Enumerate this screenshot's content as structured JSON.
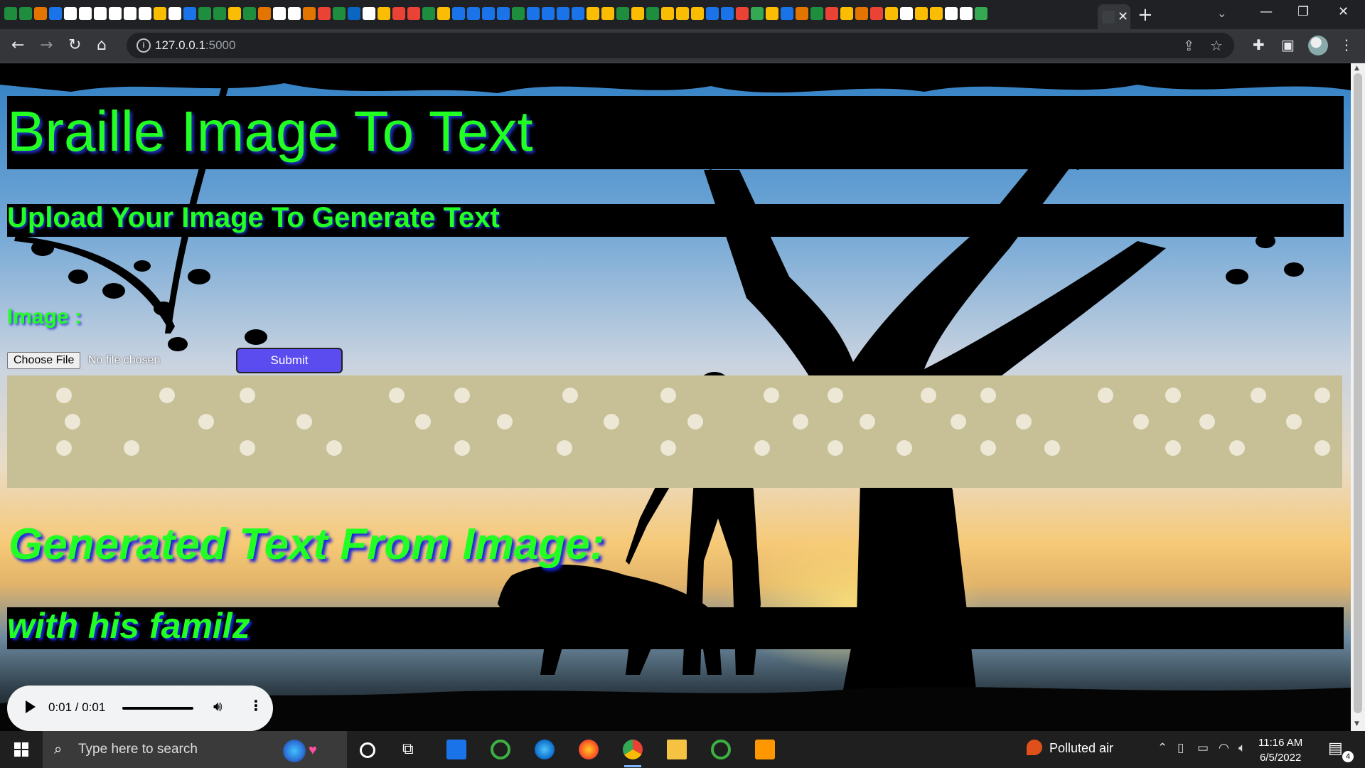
{
  "browser": {
    "url_host": "127.0.0.1",
    "url_port": ":5000",
    "new_tab_glyph": "+",
    "close_glyph": "✕",
    "window_controls": [
      "—",
      "❐",
      "✕"
    ],
    "tab_favicon_colors": [
      "#1e8e3e",
      "#1e8e3e",
      "#e37400",
      "#1a73e8",
      "#ffffff",
      "#ffffff",
      "#ffffff",
      "#ffffff",
      "#ffffff",
      "#ffffff",
      "#fbbc04",
      "#ffffff",
      "#1a73e8",
      "#1e8e3e",
      "#1e8e3e",
      "#fbbc04",
      "#1e8e3e",
      "#e37400",
      "#ffffff",
      "#ffffff",
      "#e37400",
      "#ea4335",
      "#1e8e3e",
      "#0a66c2",
      "#ffffff",
      "#fbbc04",
      "#ea4335",
      "#ea4335",
      "#1e8e3e",
      "#fbbc04",
      "#1a73e8",
      "#1a73e8",
      "#1a73e8",
      "#1a73e8",
      "#1e8e3e",
      "#1a73e8",
      "#1a73e8",
      "#1a73e8",
      "#1a73e8",
      "#fbbc04",
      "#fbbc04",
      "#1e8e3e",
      "#fbbc04",
      "#1e8e3e",
      "#fbbc04",
      "#fbbc04",
      "#fbbc04",
      "#1a73e8",
      "#1a73e8",
      "#ea4335",
      "#34a853",
      "#fbbc04",
      "#1a73e8",
      "#e37400",
      "#1e8e3e",
      "#ea4335",
      "#fbbc04",
      "#e37400",
      "#ea4335",
      "#fbbc04",
      "#ffffff",
      "#fbbc04",
      "#fbbc04",
      "#ffffff",
      "#ffffff",
      "#34a853"
    ]
  },
  "page": {
    "title": "Braille Image To Text",
    "subtitle": "Upload Your Image To Generate Text",
    "image_label": "Image :",
    "choose_file_label": "Choose File",
    "file_status": "No file chosen",
    "submit_label": "Submit",
    "generated_heading": "Generated Text From Image:",
    "generated_text": "with his familz",
    "accent_color": "#22ff22",
    "submit_color": "#5b4cf0"
  },
  "audio": {
    "time": "0:01 / 0:01",
    "progress": 1.0
  },
  "taskbar": {
    "search_placeholder": "Type here to search",
    "weather_label": "Polluted air",
    "clock_time": "11:16 AM",
    "clock_date": "6/5/2022",
    "notification_count": "4",
    "apps": [
      "task-view",
      "mail",
      "spinner-green",
      "edge",
      "firefox",
      "chrome",
      "file-explorer",
      "spinner-green",
      "sublime-text"
    ]
  }
}
